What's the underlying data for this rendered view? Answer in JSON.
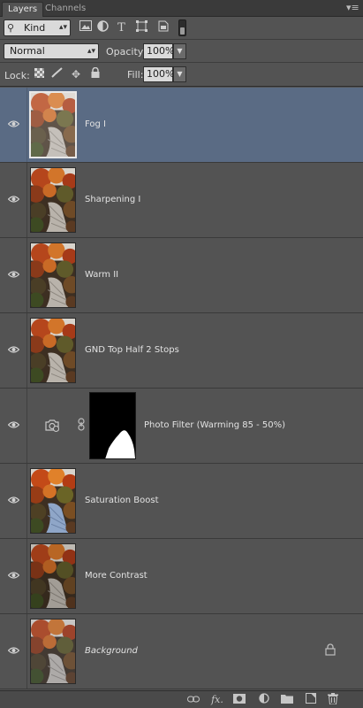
{
  "tabs": {
    "layers": "Layers",
    "channels": "Channels"
  },
  "panel_menu_icon": "panel-menu-icon",
  "filter": {
    "kind_label": "Kind",
    "icons": [
      "image-filter-icon",
      "adjustment-filter-icon",
      "type-filter-icon",
      "shape-filter-icon",
      "smart-object-filter-icon"
    ]
  },
  "blend": {
    "mode": "Normal",
    "opacity_label": "Opacity:",
    "opacity_value": "100%"
  },
  "lock": {
    "label": "Lock:",
    "fill_label": "Fill:",
    "fill_value": "100%",
    "icons": [
      "lock-transparent-icon",
      "lock-image-icon",
      "lock-position-icon",
      "lock-all-icon"
    ]
  },
  "layers": [
    {
      "name": "Fog I",
      "selected": true,
      "italic": false
    },
    {
      "name": "Sharpening I",
      "selected": false,
      "italic": false
    },
    {
      "name": "Warm II",
      "selected": false,
      "italic": false
    },
    {
      "name": "GND Top Half 2 Stops",
      "selected": false,
      "italic": false
    },
    {
      "name": "Photo Filter (Warming 85 - 50%)",
      "selected": false,
      "italic": false,
      "adjustment": true
    },
    {
      "name": "Saturation Boost",
      "selected": false,
      "italic": false
    },
    {
      "name": "More Contrast",
      "selected": false,
      "italic": false
    },
    {
      "name": "Background",
      "selected": false,
      "italic": true,
      "locked": true
    }
  ],
  "footer": {
    "icons": [
      "link-layers-icon",
      "fx-icon",
      "add-mask-icon",
      "new-adjustment-icon",
      "new-group-icon",
      "new-layer-icon",
      "delete-layer-icon"
    ]
  },
  "colors": {
    "panel_bg": "#535353",
    "selected_bg": "#5a6b84",
    "field_bg": "#dadada"
  }
}
